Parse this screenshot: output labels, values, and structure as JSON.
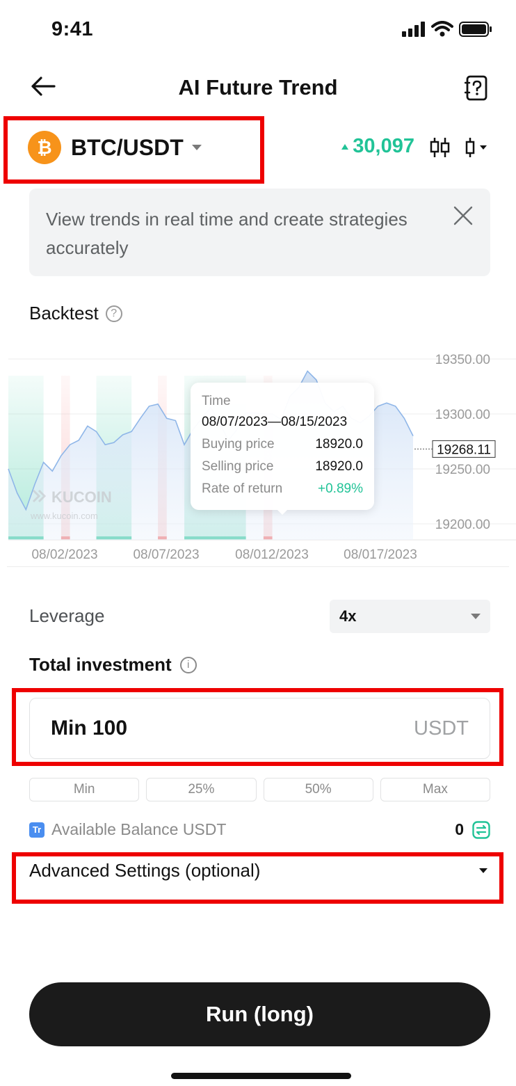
{
  "status_bar": {
    "time": "9:41"
  },
  "header": {
    "title": "AI Future Trend"
  },
  "pair": {
    "symbol": "BTC/USDT",
    "coin_glyph": "₿",
    "price": "30,097",
    "price_color": "#21c397"
  },
  "banner": {
    "text": "View trends in real time and create strategies accurately"
  },
  "backtest": {
    "label": "Backtest",
    "help_glyph": "?"
  },
  "chart_data": {
    "type": "area",
    "y_ticks": [
      "19350.00",
      "19300.00",
      "19250.00",
      "19200.00"
    ],
    "x_ticks": [
      "08/02/2023",
      "08/07/2023",
      "08/012/2023",
      "08/017/2023"
    ],
    "current_value": "19268.11",
    "ylim": [
      19190,
      19360
    ],
    "x": [
      1,
      2,
      3,
      4,
      5,
      6,
      7,
      8,
      9,
      10,
      11,
      12,
      13,
      14,
      15,
      16,
      17,
      18,
      19,
      20,
      21,
      22,
      23,
      24,
      25,
      26,
      27,
      28,
      29,
      30,
      31,
      32,
      33,
      34,
      35,
      36,
      37,
      38,
      39,
      40,
      41,
      42,
      43,
      44,
      45,
      46,
      47
    ],
    "values": [
      19250,
      19228,
      19213,
      19236,
      19256,
      19248,
      19262,
      19272,
      19276,
      19289,
      19284,
      19272,
      19274,
      19281,
      19284,
      19296,
      19307,
      19309,
      19296,
      19294,
      19272,
      19286,
      19296,
      19306,
      19292,
      19276,
      19286,
      19301,
      19301,
      19300,
      19300,
      19295,
      19316,
      19324,
      19339,
      19331,
      19310,
      19302,
      19307,
      19296,
      19292,
      19298,
      19307,
      19310,
      19307,
      19296,
      19280
    ],
    "signals": [
      {
        "range": [
          1,
          5
        ],
        "side": "buy"
      },
      {
        "range": [
          7,
          8
        ],
        "side": "sell"
      },
      {
        "range": [
          11,
          15
        ],
        "side": "buy"
      },
      {
        "range": [
          18,
          19
        ],
        "side": "sell"
      },
      {
        "range": [
          21,
          28
        ],
        "side": "buy"
      },
      {
        "range": [
          30,
          31
        ],
        "side": "sell"
      }
    ],
    "colors": {
      "line": "#8fb6e8",
      "buy": "#21c397",
      "sell": "#f06a6a"
    },
    "grid": true
  },
  "tooltip": {
    "time_label": "Time",
    "time_value": "08/07/2023—08/15/2023",
    "buying_label": "Buying price",
    "buying_value": "18920.0",
    "selling_label": "Selling price",
    "selling_value": "18920.0",
    "return_label": "Rate of return",
    "return_value": "+0.89%"
  },
  "watermark": {
    "logo_text": "KUCOIN",
    "url": "www.kucoin.com"
  },
  "leverage": {
    "label": "Leverage",
    "value": "4x"
  },
  "investment": {
    "label": "Total investment",
    "info_glyph": "i",
    "placeholder": "Min 100",
    "unit": "USDT",
    "quick_buttons": [
      "Min",
      "25%",
      "50%",
      "Max"
    ]
  },
  "balance": {
    "label": "Available Balance USDT",
    "value": "0",
    "badge": "Tr"
  },
  "advanced": {
    "label": "Advanced Settings (optional)"
  },
  "run_button": {
    "label": "Run (long)"
  },
  "highlight_color": "#ee0000"
}
